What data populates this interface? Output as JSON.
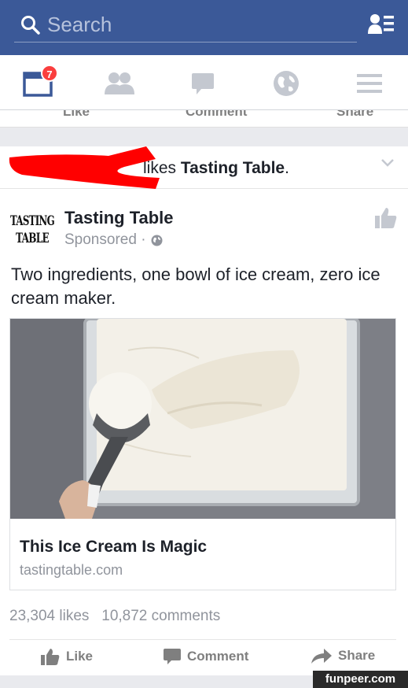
{
  "search": {
    "placeholder": "Search"
  },
  "nav": {
    "notifications_badge": "7"
  },
  "prev_story_actions": {
    "like": "Like",
    "comment": "Comment",
    "share": "Share"
  },
  "story": {
    "context_prefix": "likes ",
    "context_page": "Tasting Table",
    "context_suffix": "."
  },
  "post": {
    "logo_text": "TASTING TABLE",
    "page_name": "Tasting Table",
    "sponsored": "Sponsored",
    "separator": "·",
    "text": "Two ingredients, one bowl of ice cream, zero ice cream maker.",
    "link_title": "This Ice Cream Is Magic",
    "link_domain": "tastingtable.com",
    "likes": "23,304 likes",
    "comments": "10,872 comments"
  },
  "actions": {
    "like": "Like",
    "comment": "Comment",
    "share": "Share"
  },
  "watermark": "funpeer.com",
  "colors": {
    "brand": "#3b5998",
    "badge": "#fa3e3e",
    "redact": "#ff0000"
  }
}
